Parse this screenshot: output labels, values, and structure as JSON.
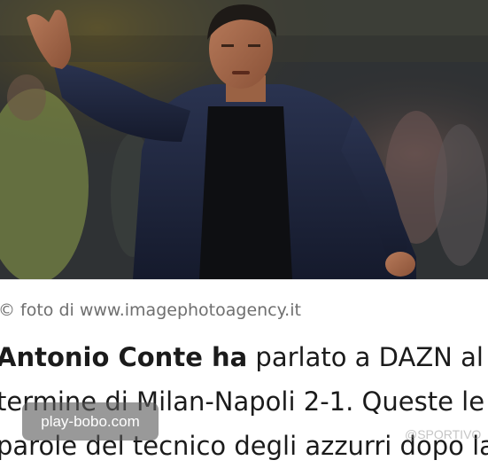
{
  "photo": {
    "alt_icon": "photo-of-coach-icon"
  },
  "caption": {
    "icon": "©",
    "text": "foto di www.imagephotoagency.it"
  },
  "article": {
    "line1_bold": "Antonio Conte ha",
    "line1_rest": " parlato a DAZN al",
    "line2": "termine di Milan-Napoli 2-1. Queste le",
    "line3": "parole del tecnico degli azzurri dopo la"
  },
  "watermark": {
    "badge": "play-bobo.com",
    "faint": "@SPORTIVO"
  },
  "colors": {
    "text": "#1b1b1b",
    "caption": "#6f6f6f",
    "badge_bg": "#5a5a5a"
  }
}
